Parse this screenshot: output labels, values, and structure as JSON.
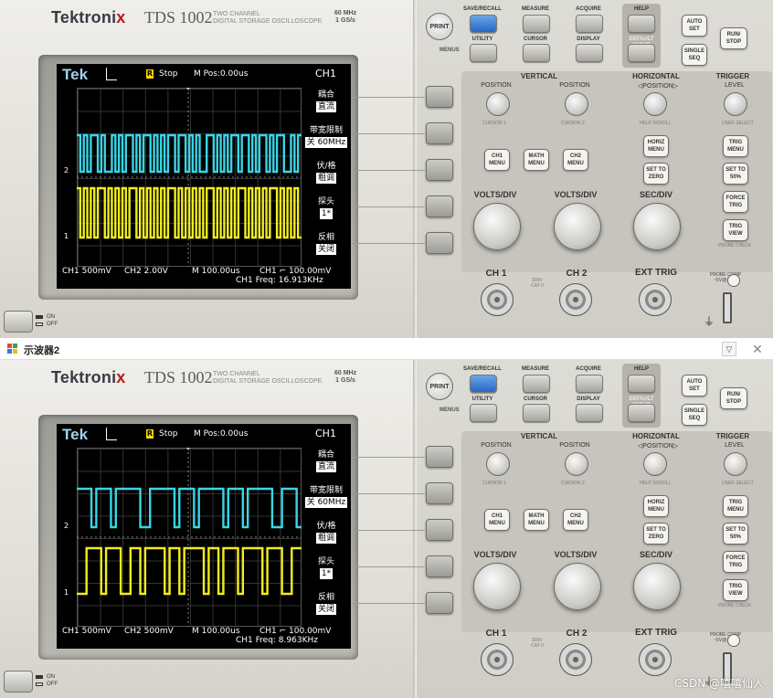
{
  "window": {
    "title": "示波器2",
    "minimize_label": "▽",
    "close_label": "✕"
  },
  "brand": {
    "name_left": "Tektroni",
    "name_x": "x",
    "model": "TDS 1002",
    "subtitle_line1": "TWO CHANNEL",
    "subtitle_line2": "DIGITAL STORAGE OSCILLOSCOPE",
    "spec_line1": "60 MHz",
    "spec_line2": "1 GS/s"
  },
  "panel": {
    "print": "PRINT",
    "menus": "MENUS",
    "save_recall": "SAVE/RECALL",
    "measure": "MEASURE",
    "acquire": "ACQUIRE",
    "help": "HELP",
    "utility": "UTILITY",
    "cursor": "CURSOR",
    "display": "DISPLAY",
    "default_setup": "DEFAULT SETUP",
    "auto_set": "AUTO\nSET",
    "single_seq": "SINGLE\nSEQ",
    "run_stop": "RUN/\nSTOP",
    "vertical": "VERTICAL",
    "horizontal": "HORIZONTAL",
    "trigger": "TRIGGER",
    "position": "POSITION",
    "h_position": "◁POSITION▷",
    "level": "LEVEL",
    "cursor1": "CURSOR 1",
    "cursor2": "CURSOR 2",
    "help_scroll": "HELP SCROLL",
    "user_select": "USER SELECT",
    "ch1_menu": "CH1\nMENU",
    "math_menu": "MATH\nMENU",
    "ch2_menu": "CH2\nMENU",
    "horiz_menu": "HORIZ\nMENU",
    "set_to_zero": "SET TO\nZERO",
    "trig_menu": "TRIG\nMENU",
    "set_to_50": "SET TO\n50%",
    "force_trig": "FORCE\nTRIG",
    "trig_view": "TRIG\nVIEW",
    "probe_check": "PROBE CHECK",
    "volts_div": "VOLTS/DIV",
    "sec_div": "SEC/DIV",
    "ch1": "CH 1",
    "ch2": "CH 2",
    "ext_trig": "EXT TRIG",
    "cat": "300V\nCAT II",
    "probe_comp": "PROBE COMP\n~5V@1kHz",
    "power_on": "ON",
    "power_off": "OFF"
  },
  "screens": [
    {
      "tek": "Tek",
      "trig_status_badge": "R",
      "stop": "Stop",
      "mpos": "M Pos:0.00us",
      "channel": "CH1",
      "menu": [
        {
          "label": "耦合",
          "value": "直流"
        },
        {
          "label": "带宽限制",
          "value": "关 60MHz"
        },
        {
          "label": "伏/格",
          "value": "粗调"
        },
        {
          "label": "探头",
          "value": "1*"
        },
        {
          "label": "反相",
          "value": "关闭"
        }
      ],
      "ch1_scale": "CH1 500mV",
      "ch2_scale": "CH2 2.00V",
      "time_scale": "M 100.00us",
      "trigger_level": "CH1 ⌐ 100.00mV",
      "freq": "CH1 Freq: 16.913KHz",
      "ch2_marker": "2",
      "ch1_marker": "1",
      "cyan_wave": [
        1,
        0,
        1,
        0,
        1,
        1,
        0,
        1,
        0,
        0,
        1,
        0,
        1,
        0,
        1,
        1,
        0,
        1,
        0,
        1,
        1,
        0,
        1,
        0,
        1,
        0,
        1,
        1,
        0,
        1,
        1,
        0,
        1,
        0,
        1,
        0,
        0,
        1,
        1,
        0,
        1,
        0,
        1,
        0,
        1,
        1,
        0,
        1,
        1,
        0,
        1,
        0,
        1,
        1,
        0,
        1,
        0,
        1,
        1,
        0,
        0,
        1,
        0,
        1
      ],
      "yellow_wave": [
        1,
        0,
        1,
        0,
        1,
        0,
        1,
        1,
        0,
        1,
        0,
        1,
        0,
        1,
        0,
        1,
        1,
        0,
        1,
        0,
        1,
        0,
        1,
        0,
        1,
        0,
        1,
        1,
        0,
        1,
        0,
        1,
        0,
        1,
        0,
        1,
        0,
        1,
        1,
        0,
        1,
        0,
        1,
        0,
        1,
        0,
        1,
        1,
        0,
        1,
        0,
        1,
        0,
        1,
        0,
        1,
        1,
        0,
        1,
        0,
        1,
        0,
        1,
        0
      ]
    },
    {
      "tek": "Tek",
      "trig_status_badge": "R",
      "stop": "Stop",
      "mpos": "M Pos:0.00us",
      "channel": "CH1",
      "menu": [
        {
          "label": "耦合",
          "value": "直流"
        },
        {
          "label": "带宽限制",
          "value": "关 60MHz"
        },
        {
          "label": "伏/格",
          "value": "粗调"
        },
        {
          "label": "探头",
          "value": "1*"
        },
        {
          "label": "反相",
          "value": "关闭"
        }
      ],
      "ch1_scale": "CH1 500mV",
      "ch2_scale": "CH2 500mV",
      "time_scale": "M 100.00us",
      "trigger_level": "CH1 ⌐ 100.00mV",
      "freq": "CH1 Freq: 8.963KHz",
      "ch2_marker": "2",
      "ch1_marker": "1",
      "cyan_wave": [
        1,
        1,
        1,
        0,
        1,
        1,
        1,
        0,
        1,
        1,
        1,
        1,
        1,
        0,
        0,
        1,
        1,
        1,
        1,
        1,
        0,
        1,
        1,
        1,
        0,
        1,
        1,
        1,
        1,
        1,
        0,
        1,
        1,
        1,
        0,
        1,
        1,
        1,
        1,
        1,
        0,
        0,
        1,
        1,
        1,
        0
      ],
      "yellow_wave": [
        0,
        0,
        1,
        1,
        1,
        0,
        1,
        1,
        1,
        0,
        0,
        1,
        1,
        0,
        1,
        1,
        1,
        1,
        0,
        1,
        1,
        0,
        1,
        1,
        1,
        1,
        0,
        1,
        1,
        0,
        1,
        1,
        1,
        0,
        1,
        1,
        1,
        1,
        0,
        1,
        1,
        1,
        0,
        0,
        1,
        1
      ]
    }
  ],
  "watermark": "CSDN @嘻嘻仙人",
  "colors": {
    "cyan": "#39d6e6",
    "yellow": "#f2ee1c",
    "blue_button": "#2e70cc"
  }
}
